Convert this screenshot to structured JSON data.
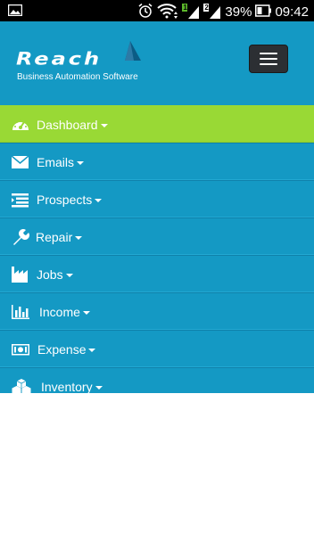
{
  "status_bar": {
    "battery_percent": "39%",
    "clock": "09:42",
    "signal_sim1_badge": "1",
    "signal_sim2_badge": "2"
  },
  "header": {
    "logo_word": "Reach",
    "logo_tagline": "Business Automation Software",
    "menu_button": "toggle-navigation"
  },
  "nav": {
    "items": [
      {
        "label": "Dashboard",
        "icon": "dashboard-gauge-icon"
      },
      {
        "label": "Emails",
        "icon": "envelope-icon"
      },
      {
        "label": "Prospects",
        "icon": "list-icon"
      },
      {
        "label": "Repair",
        "icon": "wrench-icon"
      },
      {
        "label": "Jobs",
        "icon": "factory-icon"
      },
      {
        "label": "Income",
        "icon": "bar-chart-icon"
      },
      {
        "label": "Expense",
        "icon": "money-icon"
      },
      {
        "label": "Inventory",
        "icon": "cubes-icon"
      }
    ]
  },
  "colors": {
    "header_bg": "#1499c4",
    "active_item_bg": "#99d935",
    "menu_button_bg": "#2c2f33",
    "status_bar_bg": "#000000"
  }
}
